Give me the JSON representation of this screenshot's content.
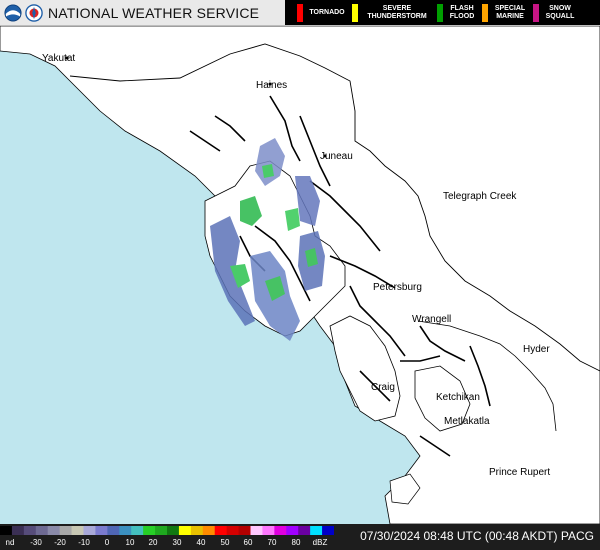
{
  "header": {
    "title": "NATIONAL WEATHER SERVICE",
    "logos": [
      "noaa-logo",
      "nws-logo"
    ]
  },
  "warnings": [
    {
      "label": "TORNADO",
      "color": "#ff0000"
    },
    {
      "label": "SEVERE\nTHUNDERSTORM",
      "color": "#ffff00"
    },
    {
      "label": "FLASH\nFLOOD",
      "color": "#00a000"
    },
    {
      "label": "SPECIAL\nMARINE",
      "color": "#ffa500"
    },
    {
      "label": "SNOW\nSQUALL",
      "color": "#c71585"
    }
  ],
  "map": {
    "cities": [
      "Yakutat",
      "Haines",
      "Juneau",
      "Telegraph Creek",
      "Petersburg",
      "Wrangell",
      "Hyder",
      "Craig",
      "Ketchikan",
      "Metlakatla",
      "Prince Rupert"
    ],
    "ocean_color": "#bfe6ee",
    "land_color": "#ffffff"
  },
  "footer": {
    "scale_labels": [
      "nd",
      "-30",
      "-20",
      "-10",
      "0",
      "10",
      "20",
      "30",
      "40",
      "50",
      "60",
      "70",
      "80",
      "dBZ"
    ],
    "scale_colors": [
      "#000000",
      "#3a2f54",
      "#564c7a",
      "#6e6a93",
      "#8a8aa9",
      "#a8a8a8",
      "#c8c8b4",
      "#a9a9d8",
      "#7b7bcf",
      "#4f66b5",
      "#3b90c0",
      "#44c0c0",
      "#27cf27",
      "#1fa91f",
      "#117811",
      "#ffff00",
      "#e8c000",
      "#ff8c00",
      "#ff0000",
      "#d40000",
      "#b40000",
      "#ffc8ff",
      "#ff78ff",
      "#e000e0",
      "#a000ff",
      "#6a00a0",
      "#00e0ff",
      "#0000c8"
    ],
    "timestamp": "07/30/2024 08:48 UTC (00:48 AKDT) PACG"
  }
}
